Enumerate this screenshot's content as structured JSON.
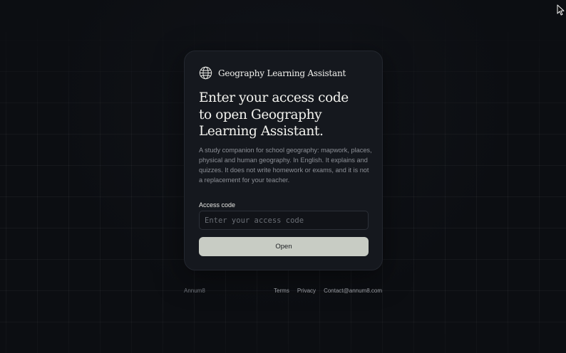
{
  "app": {
    "name": "Geography Learning Assistant"
  },
  "card": {
    "headline_lines": [
      "Enter your access code",
      "to open Geography",
      "Learning Assistant."
    ],
    "description": "A study companion for school geography: mapwork, places, physical and human geography. In English. It explains and quizzes. It does not write homework or exams, and it is not a replacement for your teacher.",
    "access_code": {
      "label": "Access code",
      "value": "",
      "placeholder": "Enter your access code"
    },
    "open_button_label": "Open"
  },
  "footer": {
    "brand": "Annum8",
    "links": [
      "Terms",
      "Privacy",
      "Contact@annum8.com"
    ]
  },
  "icons": {
    "brand": "globe-icon",
    "cursor": "mouse-pointer-icon"
  },
  "colors": {
    "page_background": "#0c0e12",
    "card_background": "#15181e",
    "button_background": "#c8ccc4",
    "button_text": "#1b1d21",
    "muted_text": "#8d9097"
  }
}
